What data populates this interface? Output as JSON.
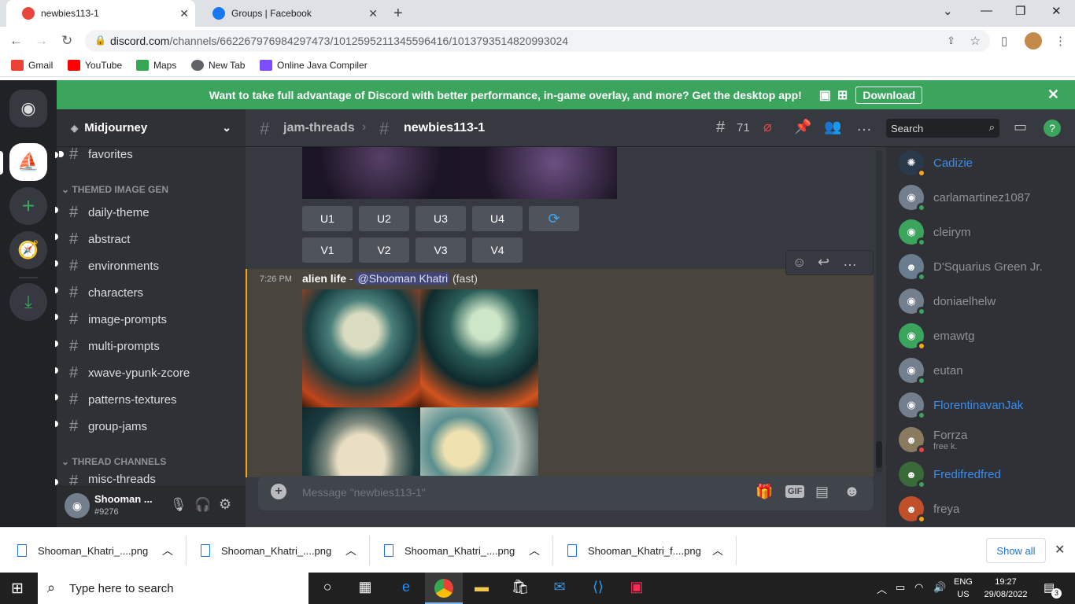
{
  "browser": {
    "tabs": [
      {
        "title": "newbies113-1",
        "favicon_color": "#e8453c"
      },
      {
        "title": "Groups | Facebook",
        "favicon_color": "#1877f2"
      }
    ],
    "url_host": "discord.com",
    "url_path": "/channels/662267976984297473/1012595211345596416/1013793514820993024",
    "bookmarks": [
      {
        "label": "Gmail",
        "color": "#ea4335"
      },
      {
        "label": "YouTube",
        "color": "#ff0000"
      },
      {
        "label": "Maps",
        "color": "#34a853"
      },
      {
        "label": "New Tab",
        "color": "#5f6368"
      },
      {
        "label": "Online Java Compiler",
        "color": "#7c4dff"
      }
    ]
  },
  "banner": {
    "text": "Want to take full advantage of Discord with better performance, in-game overlay, and more? Get the desktop app!",
    "download_label": "Download"
  },
  "server": {
    "name": "Midjourney",
    "channels_top": [
      {
        "name": "favorites"
      }
    ],
    "categories": [
      {
        "label": "THEMED IMAGE GEN",
        "channels": [
          "daily-theme",
          "abstract",
          "environments",
          "characters",
          "image-prompts",
          "multi-prompts",
          "xwave-ypunk-zcore",
          "patterns-textures",
          "group-jams"
        ]
      },
      {
        "label": "THREAD CHANNELS",
        "channels": [
          "misc-threads"
        ]
      }
    ]
  },
  "user": {
    "name": "Shooman ...",
    "tag": "#9276"
  },
  "header": {
    "parent_channel": "jam-threads",
    "thread": "newbies113-1",
    "thread_count": "71",
    "search_placeholder": "Search"
  },
  "upscale_buttons": [
    "U1",
    "U2",
    "U3",
    "U4"
  ],
  "variation_buttons": [
    "V1",
    "V2",
    "V3",
    "V4"
  ],
  "message": {
    "time": "7:26 PM",
    "prompt": "alien life",
    "separator": " - ",
    "mention": "@Shooman Khatri",
    "mode": "(fast)"
  },
  "composer": {
    "placeholder": "Message \"newbies113-1\""
  },
  "members": [
    {
      "name": "Cadizie",
      "color": "#3d8ce8",
      "status": "#faa61a"
    },
    {
      "name": "carlamartinez1087",
      "color": "#8e9297",
      "status": "#3ba55d"
    },
    {
      "name": "cleirym",
      "color": "#8e9297",
      "status": "#3ba55d"
    },
    {
      "name": "D'Squarius Green Jr.",
      "color": "#8e9297",
      "status": "#3ba55d"
    },
    {
      "name": "doniaelhelw",
      "color": "#8e9297",
      "status": "#3ba55d"
    },
    {
      "name": "emawtg",
      "color": "#8e9297",
      "status": "#faa61a"
    },
    {
      "name": "eutan",
      "color": "#8e9297",
      "status": "#3ba55d"
    },
    {
      "name": "FlorentinavanJak",
      "color": "#3d8ce8",
      "status": "#3ba55d"
    },
    {
      "name": "Forrza",
      "color": "#8e9297",
      "status": "#ed4245",
      "sub": "free k."
    },
    {
      "name": "Fredifredfred",
      "color": "#3d8ce8",
      "status": "#3ba55d"
    },
    {
      "name": "freya",
      "color": "#8e9297",
      "status": "#faa61a"
    }
  ],
  "downloads": {
    "items": [
      "Shooman_Khatri_....png",
      "Shooman_Khatri_....png",
      "Shooman_Khatri_....png",
      "Shooman_Khatri_f....png"
    ],
    "show_all": "Show all"
  },
  "taskbar": {
    "search_placeholder": "Type here to search",
    "lang_top": "ENG",
    "lang_bottom": "US",
    "time": "19:27",
    "date": "29/08/2022",
    "notifications": "3"
  }
}
